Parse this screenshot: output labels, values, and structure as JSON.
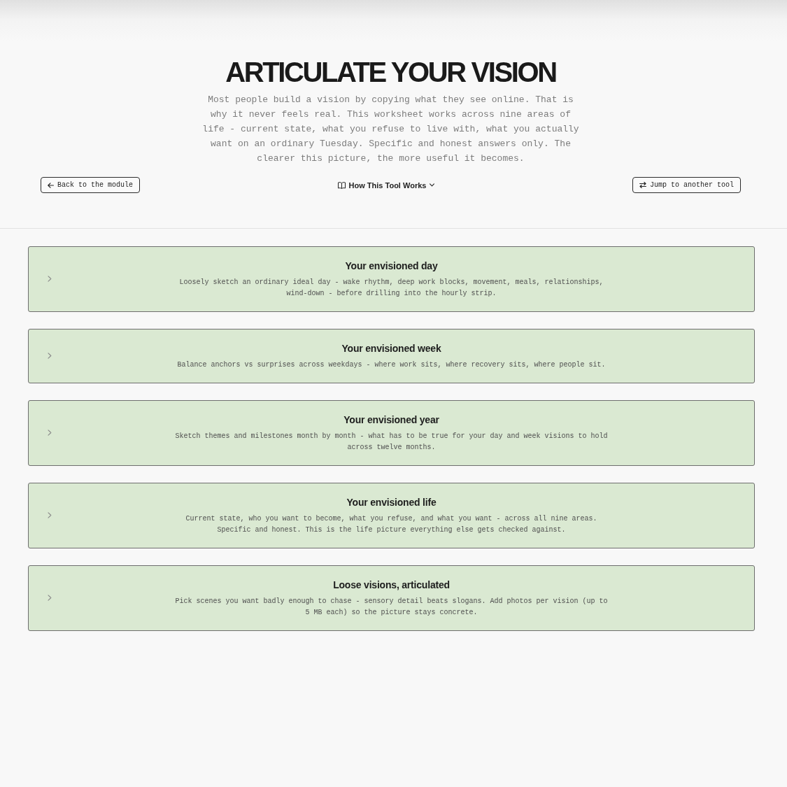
{
  "header": {
    "title": "ARTICULATE YOUR VISION",
    "intro": "Most people build a vision by copying what they see online. That is why it never feels real. This worksheet works across nine areas of life - current state, what you refuse to live with, what you actually want on an ordinary Tuesday. Specific and honest answers only. The clearer this picture, the more useful it becomes."
  },
  "nav": {
    "back_button": {
      "label": "Back to the module"
    },
    "help_toggle": {
      "label": "How This Tool Works",
      "expanded": false
    },
    "jump_button": {
      "label": "Jump to another tool"
    }
  },
  "sections": [
    {
      "title": "Your envisioned day",
      "description": "Loosely sketch an ordinary ideal day - wake rhythm, deep work blocks, movement, meals, relationships, wind-down - before drilling into the hourly strip.",
      "expanded": false
    },
    {
      "title": "Your envisioned week",
      "description": "Balance anchors vs surprises across weekdays - where work sits, where recovery sits, where people sit.",
      "expanded": false
    },
    {
      "title": "Your envisioned year",
      "description": "Sketch themes and milestones month by month - what has to be true for your day and week visions to hold across twelve months.",
      "expanded": false
    },
    {
      "title": "Your envisioned life",
      "description": "Current state, who you want to become, what you refuse, and what you want - across all nine areas. Specific and honest. This is the life picture everything else gets checked against.",
      "expanded": false
    },
    {
      "title": "Loose visions, articulated",
      "description": "Pick scenes you want badly enough to chase - sensory detail beats slogans. Add photos per vision (up to 5 MB each) so the picture stays concrete.",
      "expanded": false
    }
  ]
}
